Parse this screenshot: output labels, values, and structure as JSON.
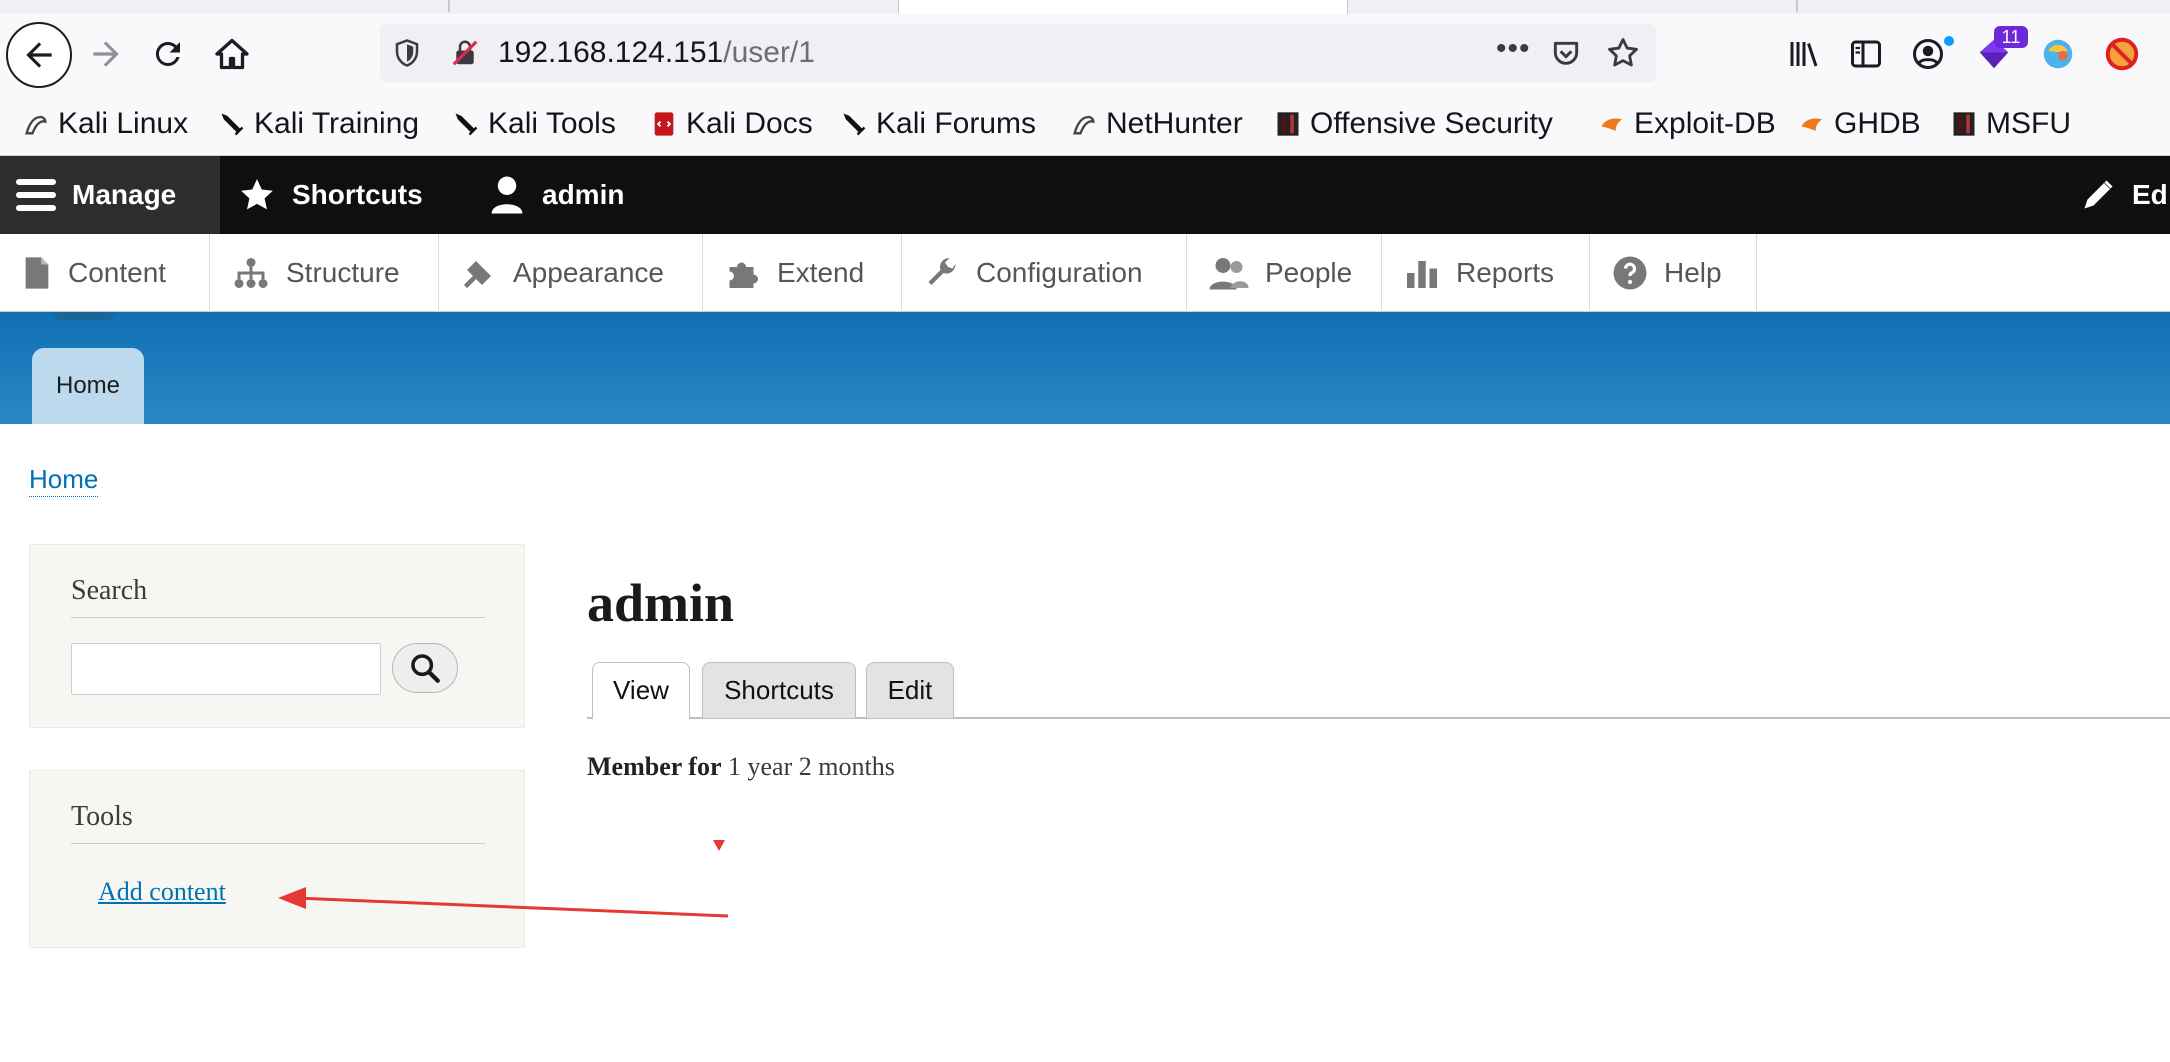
{
  "browser": {
    "url_host": "192.168.124.151",
    "url_path": "/user/1",
    "more_icon": "•••",
    "extension_badge": "11",
    "bookmarks": [
      {
        "label": "Kali Linux",
        "icon": "kali-dragon-icon"
      },
      {
        "label": "Kali Training",
        "icon": "kali-sword-icon"
      },
      {
        "label": "Kali Tools",
        "icon": "kali-sword-icon"
      },
      {
        "label": "Kali Docs",
        "icon": "kali-docs-icon"
      },
      {
        "label": "Kali Forums",
        "icon": "kali-sword-icon"
      },
      {
        "label": "NetHunter",
        "icon": "kali-dragon-icon"
      },
      {
        "label": "Offensive Security",
        "icon": "offsec-icon"
      },
      {
        "label": "Exploit-DB",
        "icon": "exploit-db-icon"
      },
      {
        "label": "GHDB",
        "icon": "exploit-db-icon"
      },
      {
        "label": "MSFU",
        "icon": "offsec-icon"
      }
    ]
  },
  "toolbar": {
    "manage": "Manage",
    "shortcuts": "Shortcuts",
    "user": "admin",
    "edit": "Ed"
  },
  "tray": {
    "items": [
      "Content",
      "Structure",
      "Appearance",
      "Extend",
      "Configuration",
      "People",
      "Reports",
      "Help"
    ]
  },
  "header": {
    "home_tab": "Home"
  },
  "breadcrumb": {
    "home": "Home"
  },
  "sidebar": {
    "search_title": "Search",
    "search_value": "",
    "tools_title": "Tools",
    "add_content": "Add content"
  },
  "main": {
    "title": "admin",
    "tabs": [
      "View",
      "Shortcuts",
      "Edit"
    ],
    "member_label": "Member for",
    "member_value": "1 year 2 months"
  },
  "colors": {
    "toolbar_bg": "#0f0f0f",
    "header_blue": "#1b7ebf",
    "link_blue": "#0071b3",
    "annotation_red": "#e53935"
  }
}
